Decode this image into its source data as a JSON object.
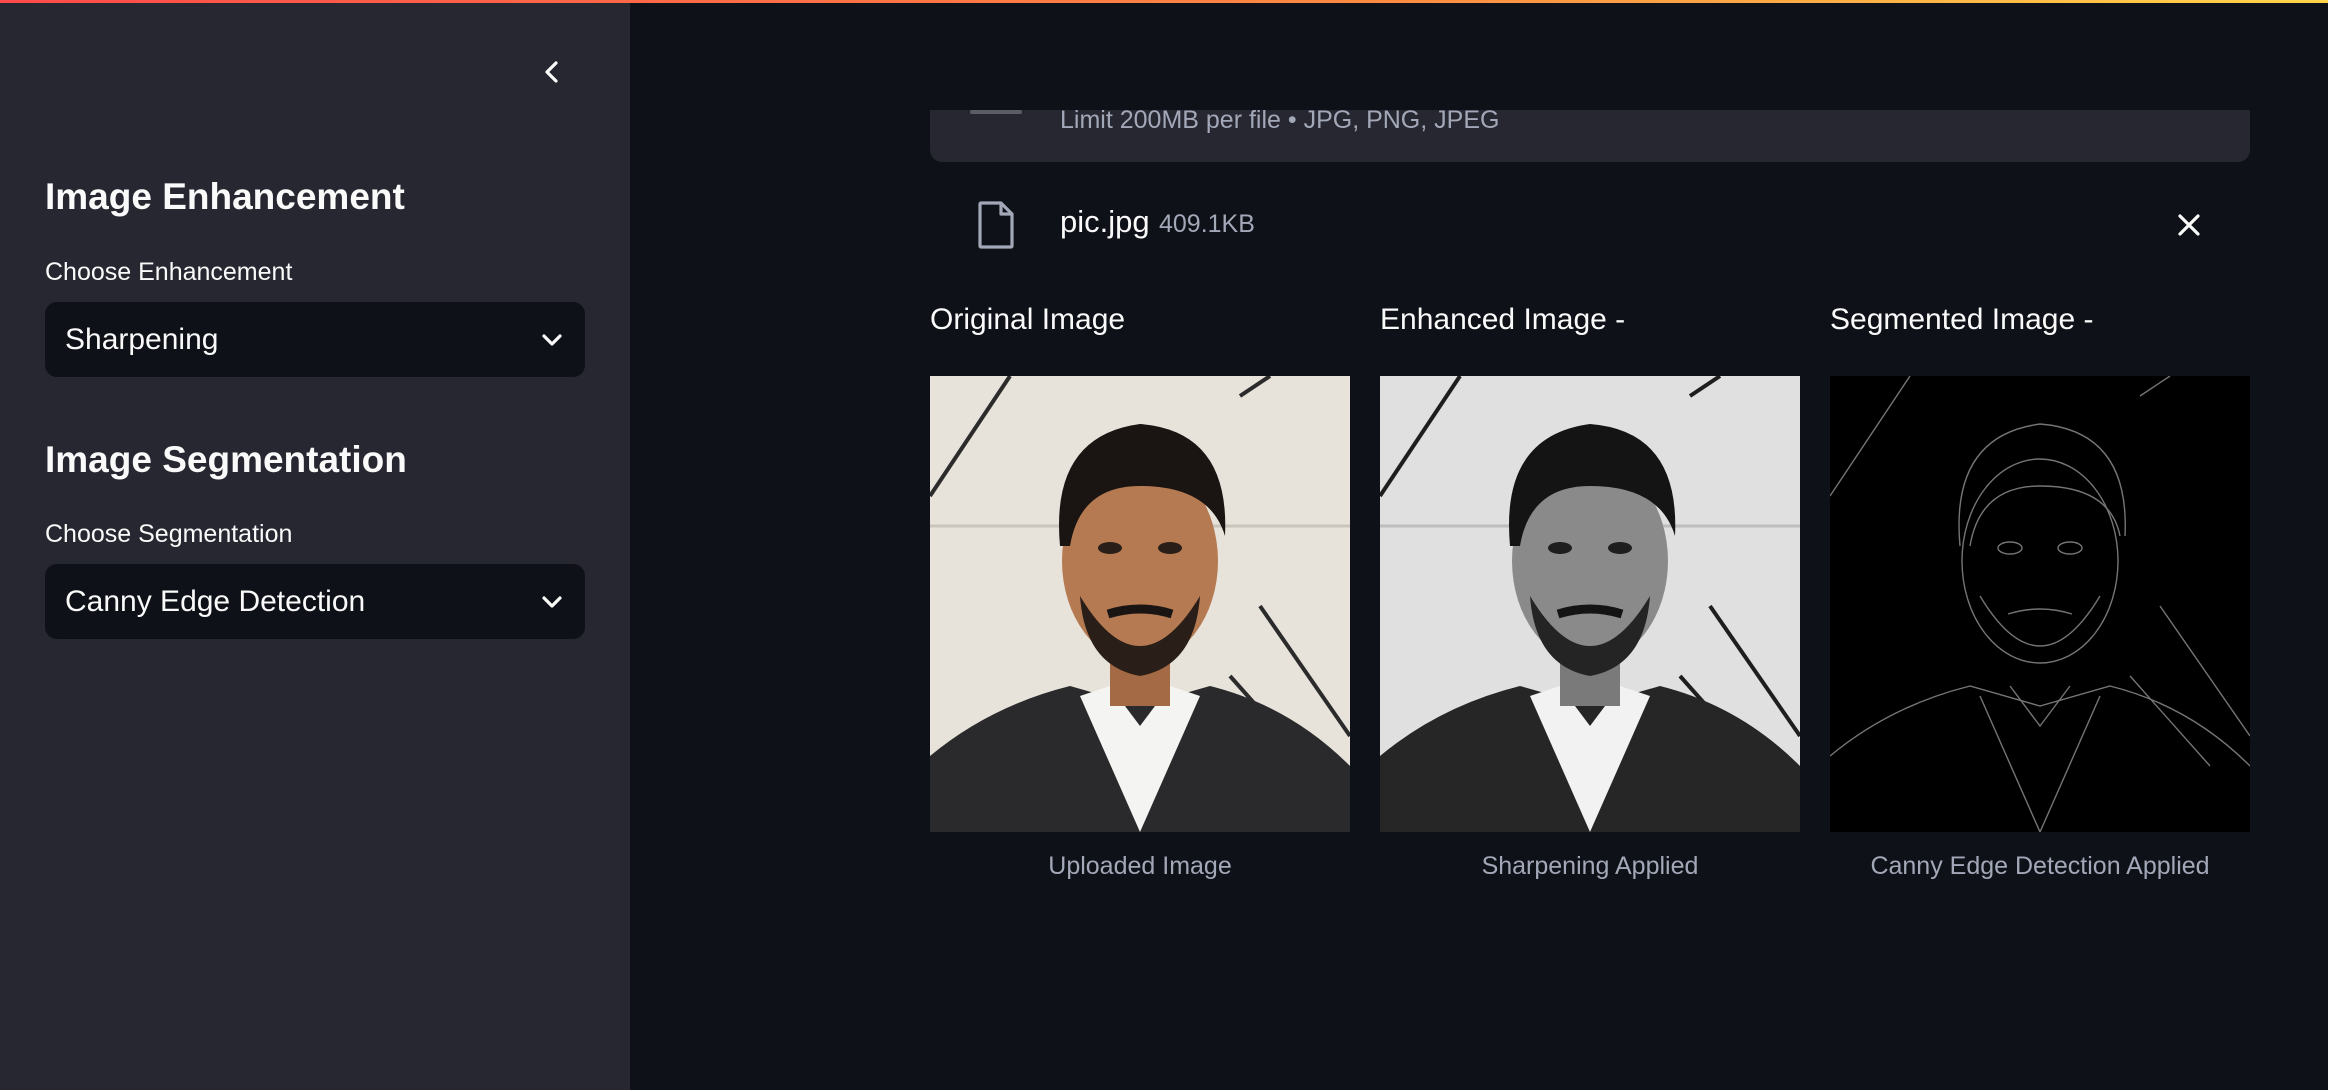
{
  "sidebar": {
    "collapse_icon": "chevron-left-icon",
    "enhancement": {
      "heading": "Image Enhancement",
      "label": "Choose Enhancement",
      "selected": "Sharpening"
    },
    "segmentation": {
      "heading": "Image Segmentation",
      "label": "Choose Segmentation",
      "selected": "Canny Edge Detection"
    }
  },
  "uploader": {
    "limit_text": "Limit 200MB per file • JPG, PNG, JPEG",
    "file": {
      "name": "pic.jpg",
      "size": "409.1KB",
      "icon": "file-icon",
      "remove_icon": "close-icon"
    }
  },
  "columns": [
    {
      "title": "Original Image",
      "caption": "Uploaded Image",
      "image": "portrait color photo"
    },
    {
      "title": "Enhanced Image -",
      "caption": "Sharpening Applied",
      "image": "portrait grayscale sharpened"
    },
    {
      "title": "Segmented Image -",
      "caption": "Canny Edge Detection Applied",
      "image": "portrait canny edges"
    }
  ],
  "colors": {
    "background": "#0e1117",
    "sidebar": "#262730",
    "accent_gradient_start": "#ff4b4b",
    "accent_gradient_end": "#ffd54a"
  }
}
